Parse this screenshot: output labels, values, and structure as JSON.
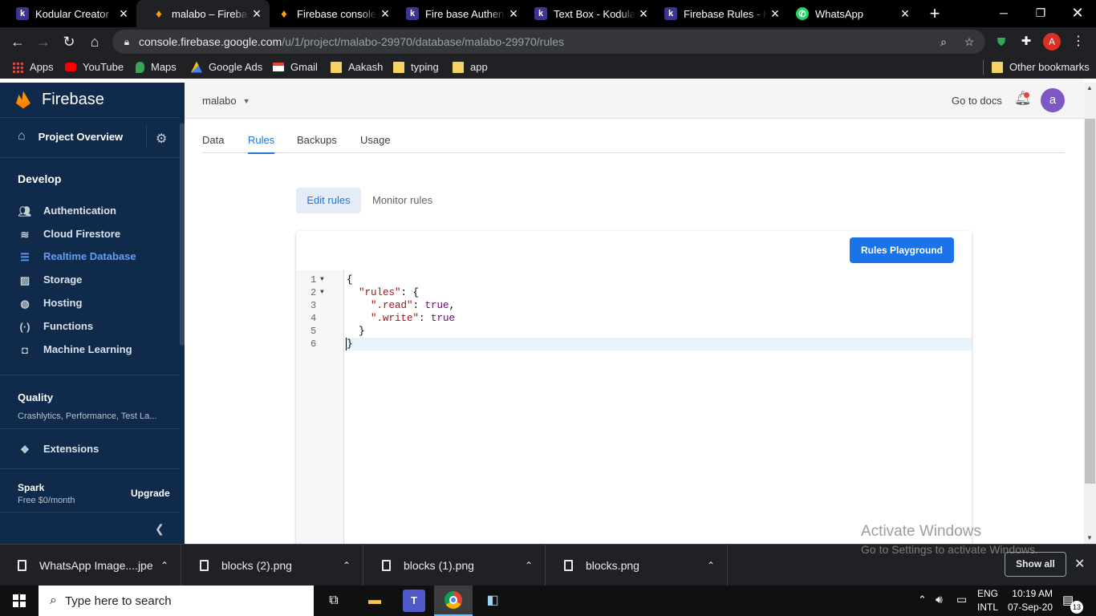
{
  "browser": {
    "tabs": [
      {
        "title": "Kodular Creator",
        "icon": "kodular-icon"
      },
      {
        "title": "malabo – Firebase",
        "icon": "firebase-icon",
        "active": true
      },
      {
        "title": "Firebase console",
        "icon": "firebase-icon"
      },
      {
        "title": "Fire base Authenti",
        "icon": "kodular-icon"
      },
      {
        "title": "Text Box - Kodular",
        "icon": "kodular-icon"
      },
      {
        "title": "Firebase Rules - Ko",
        "icon": "kodular-icon"
      },
      {
        "title": "WhatsApp",
        "icon": "whatsapp-icon"
      }
    ],
    "url_host": "console.firebase.google.com",
    "url_path": "/u/1/project/malabo-29970/database/malabo-29970/rules",
    "profile_initial": "A",
    "bookmarks": [
      "Apps",
      "YouTube",
      "Maps",
      "Google Ads",
      "Gmail",
      "Aakash",
      "typing",
      "app"
    ],
    "other_bookmarks": "Other bookmarks"
  },
  "sidebar": {
    "brand": "Firebase",
    "project_overview": "Project Overview",
    "develop_heading": "Develop",
    "develop_items": [
      {
        "label": "Authentication",
        "icon": "people-icon"
      },
      {
        "label": "Cloud Firestore",
        "icon": "firestore-icon"
      },
      {
        "label": "Realtime Database",
        "icon": "database-icon",
        "selected": true
      },
      {
        "label": "Storage",
        "icon": "image-icon"
      },
      {
        "label": "Hosting",
        "icon": "globe-icon"
      },
      {
        "label": "Functions",
        "icon": "functions-icon"
      },
      {
        "label": "Machine Learning",
        "icon": "robot-icon"
      }
    ],
    "quality_heading": "Quality",
    "quality_sub": "Crashlytics, Performance, Test La...",
    "extensions": "Extensions",
    "plan_name": "Spark",
    "plan_price": "Free $0/month",
    "upgrade": "Upgrade"
  },
  "header": {
    "project": "malabo",
    "go_to_docs": "Go to docs",
    "avatar_initial": "a"
  },
  "tabs": [
    "Data",
    "Rules",
    "Backups",
    "Usage"
  ],
  "selected_tab": "Rules",
  "rules_mode": {
    "edit": "Edit rules",
    "monitor": "Monitor rules"
  },
  "rules_playground": "Rules Playground",
  "editor_lines": [
    "{",
    "  \"rules\": {",
    "    \".read\": true,",
    "    \".write\": true",
    "  }",
    "}"
  ],
  "watermark": {
    "title": "Activate Windows",
    "subtitle": "Go to Settings to activate Windows."
  },
  "downloads": [
    "WhatsApp Image....jpeg",
    "blocks (2).png",
    "blocks (1).png",
    "blocks.png"
  ],
  "show_all": "Show all",
  "taskbar": {
    "search_placeholder": "Type here to search",
    "lang_top": "ENG",
    "lang_bottom": "INTL",
    "time": "10:19 AM",
    "date": "07-Sep-20",
    "notification_count": "13"
  }
}
